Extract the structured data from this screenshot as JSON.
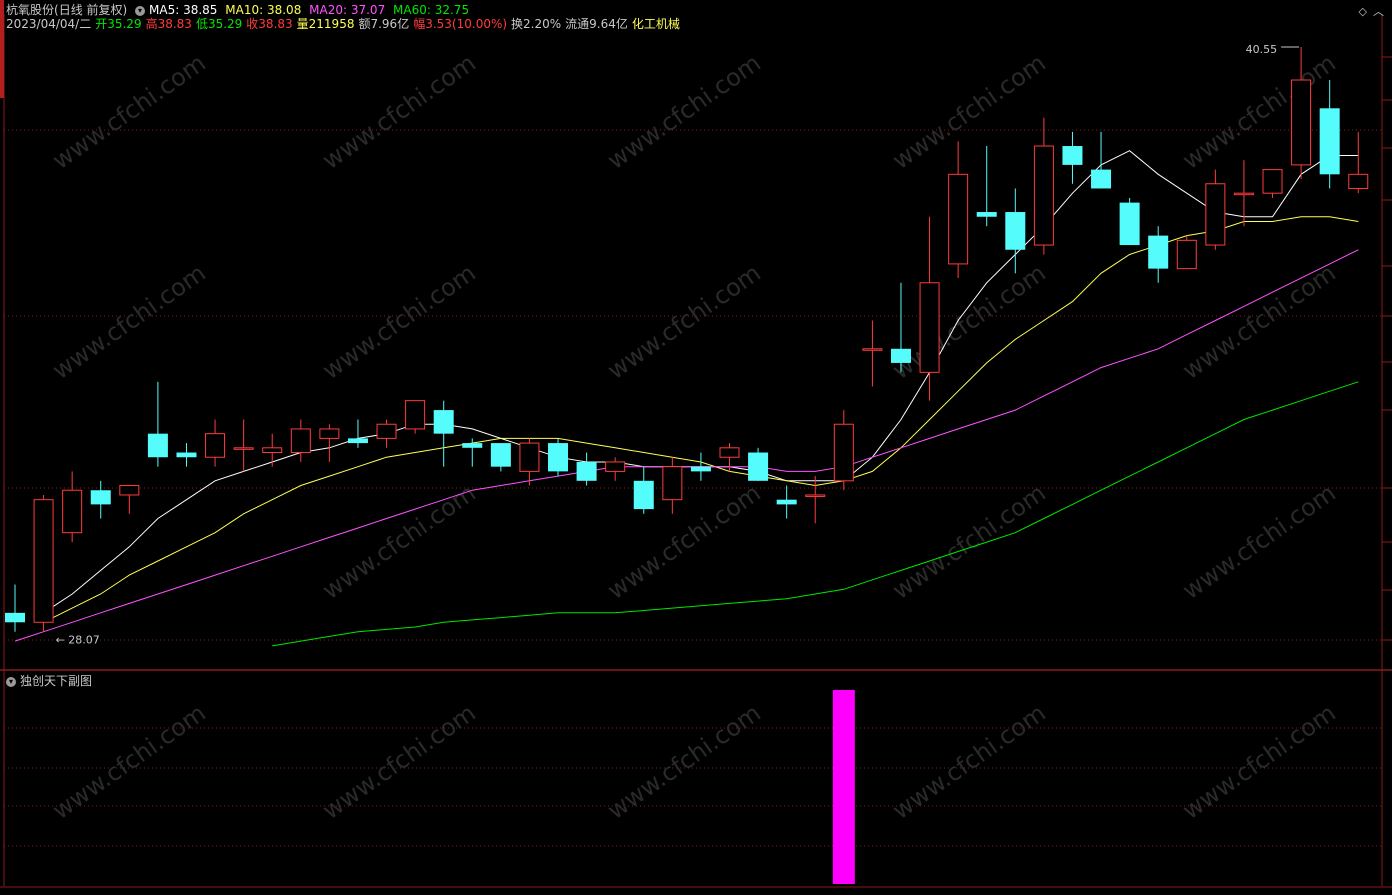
{
  "header": {
    "stock_name": "杭氧股份",
    "period": "(日线 前复权)",
    "ma5_label": "MA5: 38.85",
    "ma10_label": "MA10: 38.08",
    "ma20_label": "MA20: 37.07",
    "ma60_label": "MA60: 32.75",
    "date": "2023/04/04/二",
    "open": "开35.29",
    "high": "高38.83",
    "low": "低35.29",
    "close": "收38.83",
    "volume": "量211958",
    "amount": "额7.96亿",
    "change": "幅3.53(10.00%)",
    "turnover": "换2.20%",
    "float_cap": "流通9.64亿",
    "industry": "化工机械"
  },
  "subchart": {
    "title": "独创天下副图"
  },
  "colors": {
    "up": "#ff3c3c",
    "down": "#54fcfc",
    "ma5": "#ffffff",
    "ma10": "#ffff54",
    "ma20": "#ff54ff",
    "ma60": "#00e600",
    "grid": "#8b1a1a",
    "signal": "#ff00ff",
    "watermark": "#2a2a2a"
  },
  "chart_data": [
    {
      "type": "candlestick",
      "price_range": [
        27.5,
        41.2
      ],
      "annotations": {
        "high_label": "40.55",
        "low_label": "28.07"
      },
      "candles": [
        {
          "o": 28.5,
          "h": 29.1,
          "l": 28.1,
          "c": 28.3
        },
        {
          "o": 28.3,
          "h": 31.0,
          "l": 28.1,
          "c": 30.9
        },
        {
          "o": 30.2,
          "h": 31.5,
          "l": 30.0,
          "c": 31.1
        },
        {
          "o": 31.1,
          "h": 31.3,
          "l": 30.5,
          "c": 30.8
        },
        {
          "o": 31.0,
          "h": 31.2,
          "l": 30.6,
          "c": 31.2
        },
        {
          "o": 32.3,
          "h": 33.4,
          "l": 31.6,
          "c": 31.8
        },
        {
          "o": 31.9,
          "h": 32.1,
          "l": 31.6,
          "c": 31.8
        },
        {
          "o": 31.8,
          "h": 32.6,
          "l": 31.6,
          "c": 32.3
        },
        {
          "o": 32.0,
          "h": 32.6,
          "l": 31.5,
          "c": 32.0
        },
        {
          "o": 31.9,
          "h": 32.3,
          "l": 31.6,
          "c": 32.0
        },
        {
          "o": 31.9,
          "h": 32.6,
          "l": 31.7,
          "c": 32.4
        },
        {
          "o": 32.2,
          "h": 32.5,
          "l": 31.7,
          "c": 32.4
        },
        {
          "o": 32.2,
          "h": 32.6,
          "l": 32.0,
          "c": 32.1
        },
        {
          "o": 32.2,
          "h": 32.6,
          "l": 32.0,
          "c": 32.5
        },
        {
          "o": 32.4,
          "h": 33.0,
          "l": 32.3,
          "c": 33.0
        },
        {
          "o": 32.8,
          "h": 33.0,
          "l": 31.6,
          "c": 32.3
        },
        {
          "o": 32.1,
          "h": 32.2,
          "l": 31.6,
          "c": 32.0
        },
        {
          "o": 32.1,
          "h": 32.1,
          "l": 31.5,
          "c": 31.6
        },
        {
          "o": 31.5,
          "h": 32.2,
          "l": 31.2,
          "c": 32.1
        },
        {
          "o": 32.1,
          "h": 32.2,
          "l": 31.4,
          "c": 31.5
        },
        {
          "o": 31.7,
          "h": 31.9,
          "l": 31.2,
          "c": 31.3
        },
        {
          "o": 31.5,
          "h": 31.8,
          "l": 31.3,
          "c": 31.7
        },
        {
          "o": 31.3,
          "h": 31.6,
          "l": 30.6,
          "c": 30.7
        },
        {
          "o": 30.9,
          "h": 31.8,
          "l": 30.6,
          "c": 31.6
        },
        {
          "o": 31.6,
          "h": 31.9,
          "l": 31.3,
          "c": 31.5
        },
        {
          "o": 31.8,
          "h": 32.1,
          "l": 31.5,
          "c": 32.0
        },
        {
          "o": 31.9,
          "h": 32.0,
          "l": 31.3,
          "c": 31.3
        },
        {
          "o": 30.9,
          "h": 31.2,
          "l": 30.5,
          "c": 30.8
        },
        {
          "o": 31.0,
          "h": 31.4,
          "l": 30.4,
          "c": 31.0
        },
        {
          "o": 31.3,
          "h": 32.8,
          "l": 31.1,
          "c": 32.5
        },
        {
          "o": 34.1,
          "h": 34.7,
          "l": 33.3,
          "c": 34.1
        },
        {
          "o": 34.1,
          "h": 35.5,
          "l": 33.6,
          "c": 33.8
        },
        {
          "o": 33.6,
          "h": 36.9,
          "l": 33.0,
          "c": 35.5
        },
        {
          "o": 35.9,
          "h": 38.5,
          "l": 35.6,
          "c": 37.8
        },
        {
          "o": 37.0,
          "h": 38.4,
          "l": 36.7,
          "c": 36.9
        },
        {
          "o": 37.0,
          "h": 37.5,
          "l": 35.7,
          "c": 36.2
        },
        {
          "o": 36.3,
          "h": 39.0,
          "l": 36.1,
          "c": 38.4
        },
        {
          "o": 38.4,
          "h": 38.7,
          "l": 37.6,
          "c": 38.0
        },
        {
          "o": 37.9,
          "h": 38.7,
          "l": 37.5,
          "c": 37.5
        },
        {
          "o": 37.2,
          "h": 37.3,
          "l": 36.3,
          "c": 36.3
        },
        {
          "o": 36.5,
          "h": 36.7,
          "l": 35.5,
          "c": 35.8
        },
        {
          "o": 35.8,
          "h": 36.5,
          "l": 35.8,
          "c": 36.4
        },
        {
          "o": 36.3,
          "h": 37.9,
          "l": 36.2,
          "c": 37.6
        },
        {
          "o": 37.4,
          "h": 38.1,
          "l": 36.7,
          "c": 37.4
        },
        {
          "o": 37.4,
          "h": 37.9,
          "l": 37.3,
          "c": 37.9
        },
        {
          "o": 38.0,
          "h": 40.5,
          "l": 37.7,
          "c": 39.8
        },
        {
          "o": 39.2,
          "h": 39.8,
          "l": 37.5,
          "c": 37.8
        },
        {
          "o": 37.5,
          "h": 38.7,
          "l": 37.4,
          "c": 37.8
        }
      ],
      "series": [
        {
          "name": "MA5",
          "values": [
            null,
            28.5,
            28.9,
            29.4,
            29.9,
            30.5,
            30.9,
            31.3,
            31.5,
            31.7,
            31.9,
            32.0,
            32.2,
            32.3,
            32.5,
            32.5,
            32.4,
            32.2,
            32.0,
            31.8,
            31.7,
            31.7,
            31.6,
            31.6,
            31.6,
            31.6,
            31.5,
            31.3,
            31.3,
            31.3,
            31.8,
            32.6,
            33.6,
            34.7,
            35.5,
            36.1,
            36.7,
            37.4,
            38.0,
            38.3,
            37.8,
            37.4,
            37.0,
            36.9,
            36.9,
            37.8,
            38.2,
            38.2
          ]
        },
        {
          "name": "MA10",
          "values": [
            null,
            28.3,
            28.6,
            28.9,
            29.3,
            29.6,
            29.9,
            30.2,
            30.6,
            30.9,
            31.2,
            31.4,
            31.6,
            31.8,
            31.9,
            32.0,
            32.1,
            32.2,
            32.2,
            32.2,
            32.1,
            32.0,
            31.9,
            31.8,
            31.7,
            31.5,
            31.4,
            31.3,
            31.2,
            31.3,
            31.5,
            32.0,
            32.6,
            33.2,
            33.8,
            34.3,
            34.7,
            35.1,
            35.7,
            36.1,
            36.3,
            36.5,
            36.6,
            36.8,
            36.8,
            36.9,
            36.9,
            36.8
          ]
        },
        {
          "name": "MA20",
          "values": [
            27.9,
            28.1,
            28.3,
            28.5,
            28.7,
            28.9,
            29.1,
            29.3,
            29.5,
            29.7,
            29.9,
            30.1,
            30.3,
            30.5,
            30.7,
            30.9,
            31.1,
            31.2,
            31.3,
            31.4,
            31.5,
            31.6,
            31.6,
            31.6,
            31.6,
            31.6,
            31.6,
            31.5,
            31.5,
            31.6,
            31.8,
            32.0,
            32.2,
            32.4,
            32.6,
            32.8,
            33.1,
            33.4,
            33.7,
            33.9,
            34.1,
            34.4,
            34.7,
            35.0,
            35.3,
            35.6,
            35.9,
            36.2
          ]
        },
        {
          "name": "MA60",
          "values": [
            null,
            null,
            null,
            null,
            null,
            null,
            null,
            null,
            null,
            27.8,
            27.9,
            28.0,
            28.1,
            28.15,
            28.2,
            28.3,
            28.35,
            28.4,
            28.45,
            28.5,
            28.5,
            28.5,
            28.55,
            28.6,
            28.65,
            28.7,
            28.75,
            28.8,
            28.9,
            29.0,
            29.2,
            29.4,
            29.6,
            29.8,
            30.0,
            30.2,
            30.5,
            30.8,
            31.1,
            31.4,
            31.7,
            32.0,
            32.3,
            32.6,
            32.8,
            33.0,
            33.2,
            33.4
          ]
        }
      ]
    },
    {
      "type": "bar",
      "title": "独创天下副图",
      "signal_index": 29,
      "signal_value": 1,
      "value_range": [
        0,
        1
      ]
    }
  ]
}
